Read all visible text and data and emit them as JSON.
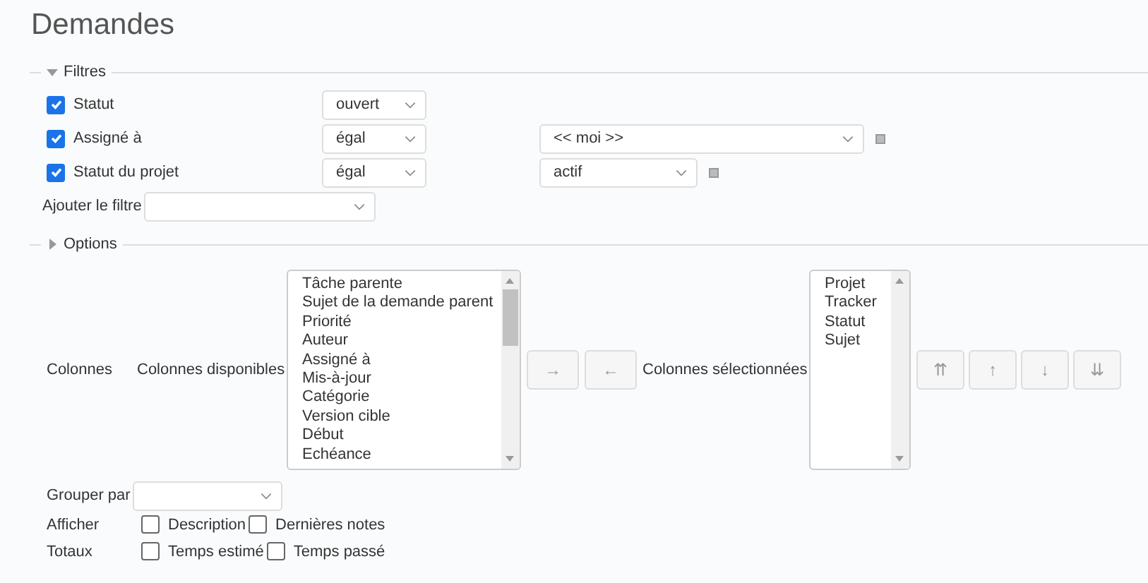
{
  "page": {
    "title": "Demandes"
  },
  "filters": {
    "legend": "Filtres",
    "expanded": true,
    "rows": [
      {
        "label": "Statut",
        "checked": true,
        "operator": "ouvert"
      },
      {
        "label": "Assigné à",
        "checked": true,
        "operator": "égal",
        "value": "<< moi >>",
        "kind": "wide"
      },
      {
        "label": "Statut du projet",
        "checked": true,
        "operator": "égal",
        "value": "actif",
        "kind": "narrow"
      }
    ],
    "add_filter": {
      "label": "Ajouter le filtre"
    }
  },
  "options": {
    "legend": "Options",
    "expanded": false,
    "columns_label": "Colonnes",
    "available_label": "Colonnes disponibles",
    "available": [
      "Tâche parente",
      "Sujet de la demande parent",
      "Priorité",
      "Auteur",
      "Assigné à",
      "Mis-à-jour",
      "Catégorie",
      "Version cible",
      "Début",
      "Echéance"
    ],
    "move_buttons": [
      "→",
      "←"
    ],
    "selected_label": "Colonnes sélectionnées",
    "selected": [
      "Projet",
      "Tracker",
      "Statut",
      "Sujet"
    ],
    "order_buttons": [
      "⇈",
      "↑",
      "↓",
      "⇊"
    ],
    "group_by": {
      "label": "Grouper par"
    },
    "show": {
      "label": "Afficher",
      "items": [
        {
          "label": "Description",
          "checked": false
        },
        {
          "label": "Dernières notes",
          "checked": false
        }
      ]
    },
    "totals": {
      "label": "Totaux",
      "items": [
        {
          "label": "Temps estimé",
          "checked": false
        },
        {
          "label": "Temps passé",
          "checked": false
        }
      ]
    }
  }
}
